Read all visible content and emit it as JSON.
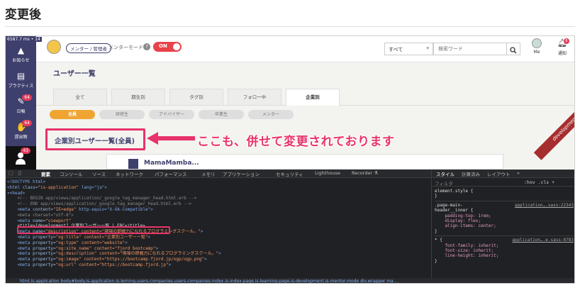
{
  "heading": "変更後",
  "timing": "6587.7 ms",
  "timing_count": "14",
  "sidebar": {
    "items": [
      {
        "label": "お知らせ"
      },
      {
        "label": "プラクティス"
      },
      {
        "label": "日報",
        "badge": "64"
      },
      {
        "label": "提出物",
        "badge": "64"
      },
      {
        "label": "",
        "badge": "43"
      }
    ]
  },
  "topbar": {
    "mentor_tag": "メンター / 管理者",
    "mentor_mode": "メンターモード",
    "toggle_label": "ON",
    "filter_value": "すべて",
    "search_placeholder": "検索ワード",
    "me_label": "Me",
    "notif_label": "通知",
    "notif_badge": "6"
  },
  "page_title": "ユーザー一覧",
  "tabs": [
    "全て",
    "期生別",
    "タグ別",
    "フォロー中",
    "企業別"
  ],
  "pills": [
    "全員",
    "研修生",
    "アドバイザー",
    "卒業生",
    "メンター"
  ],
  "section_title": "企業別ユーザー一覧(全員)",
  "callout": "ここも、併せて変更されております",
  "ribbon": "development",
  "card_peek": "MamaMamba...",
  "colors": {
    "brand": "#3e3f6d",
    "accent": "#e8336a",
    "pill_active": "#f0a533",
    "toggle": "#e8424b"
  },
  "devtools": {
    "tabs": [
      "要素",
      "コンソール",
      "ソース",
      "ネットワーク",
      "パフォーマンス",
      "メモリ",
      "アプリケーション",
      "セキュリティ",
      "Lighthouse",
      "Recorder ⚗"
    ],
    "code_lines": [
      {
        "tag": "<!DOCTYPE html>"
      },
      {
        "tag": "<html ",
        "attr": "class=",
        "val": "\"is-application\"",
        "rest": " lang=\"ja\">"
      },
      {
        "tag": "▾<head>"
      },
      {
        "com": "    <!-- BEGIN app/views/application/_google_tag_manager_head.html.erb -->"
      },
      {
        "com": "    <!-- END app/views/application/_google_tag_manager_head.html.erb -->"
      },
      {
        "tag": "    <meta ",
        "attr": "content=",
        "val": "\"IE=edge\"",
        "rest": " http-equiv=\"X-UA-Compatible\">"
      },
      {
        "com": "    <meta charset=\"utf-8\">"
      },
      {
        "tag": "    <meta ",
        "attr": "name=",
        "val": "\"viewport\"",
        "rest": ""
      },
      {
        "title": "    <title>[development] 企業別ユーザー一覧 | FBC</title>"
      },
      {
        "tag": "    <meta ",
        "attr": "name=",
        "val": "\"description\" content=\"現場の即戦力になれるプログラミングスクール。\"",
        "rest": ">"
      },
      {
        "tag": "    <meta ",
        "attr": "property=",
        "val": "\"og:title\" content=\"企業別ユーザー一覧\"",
        "rest": ">"
      },
      {
        "tag": "    <meta ",
        "attr": "property=",
        "val": "\"og:type\" content=\"website\"",
        "rest": ">"
      },
      {
        "tag": "    <meta ",
        "attr": "property=",
        "val": "\"og:site_name\" content=\"fjord bootcamp\"",
        "rest": ">"
      },
      {
        "tag": "    <meta ",
        "attr": "property=",
        "val": "\"og:description\" content=\"現場の即戦力になれるプログラミングスクール。\"",
        "rest": ">"
      },
      {
        "tag": "    <meta ",
        "attr": "property=",
        "val": "\"og:image\" content=\"https://bootcamp.fjord.jp/ogp/ogp.png\"",
        "rest": ">"
      },
      {
        "tag": "    <meta ",
        "attr": "property=",
        "val": "\"og:url\" content=\"https://bootcamp.fjord.jp\"",
        "rest": ">"
      }
    ],
    "breadcrumb": "html.is-application   body#body.is-application.is-lerning.users-companies.users-companies-index.is-index-page.is-learning-page.is-development.is-mentor-mode   div.wrapper   ma ...",
    "styles_tabs": [
      "スタイル",
      "計算済み",
      "レイアウト",
      "»"
    ],
    "styles_filter": "フィルタ",
    "styles_hov": ":hov  .cls  +",
    "styles_lines": [
      {
        "text": "element.style {"
      },
      {
        "text": "}"
      },
      {
        "sep": true
      },
      {
        "text": ".page-main-",
        "link": "application….sass:22343"
      },
      {
        "text": "header__inner {"
      },
      {
        "text": "    padding-top: 1rem;",
        "prop": true
      },
      {
        "text": "    display: flex;",
        "prop": true
      },
      {
        "text": "    align-items: center;",
        "prop": true
      },
      {
        "text": "}"
      },
      {
        "sep": true
      },
      {
        "text": "* {",
        "link": "application….e.sass:8783"
      },
      {
        "text": "    font-family: inherit;",
        "prop": true
      },
      {
        "text": "    font-size: inherit;",
        "prop": true
      },
      {
        "text": "    line-height: inherit;",
        "prop": true
      },
      {
        "text": "}"
      }
    ]
  }
}
